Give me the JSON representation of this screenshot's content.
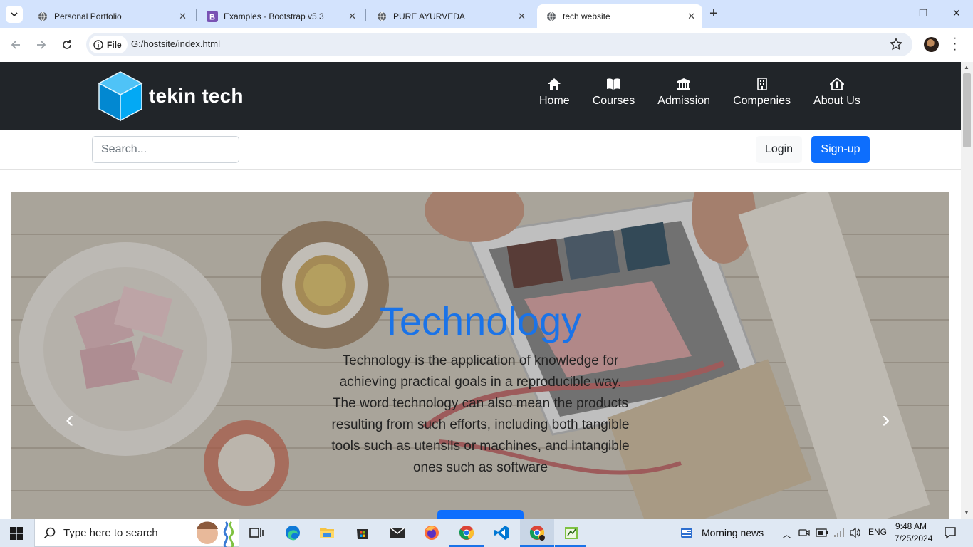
{
  "browser": {
    "tabs": [
      {
        "title": "Personal Portfolio",
        "favicon": "globe-icon"
      },
      {
        "title": "Examples · Bootstrap v5.3",
        "favicon": "bootstrap-icon"
      },
      {
        "title": "PURE AYURVEDA",
        "favicon": "globe-icon"
      },
      {
        "title": "tech website",
        "favicon": "globe-icon",
        "active": true
      }
    ],
    "address": {
      "chip_label": "File",
      "url": "G:/hostsite/index.html"
    }
  },
  "site": {
    "brand": "tekin tech",
    "nav": [
      {
        "label": "Home",
        "icon": "house-icon"
      },
      {
        "label": "Courses",
        "icon": "book-icon"
      },
      {
        "label": "Admission",
        "icon": "bank-icon"
      },
      {
        "label": "Compenies",
        "icon": "building-icon"
      },
      {
        "label": "About Us",
        "icon": "house-info-icon"
      }
    ],
    "search_placeholder": "Search...",
    "login_label": "Login",
    "signup_label": "Sign-up",
    "hero": {
      "title": "Technology",
      "text": "Technology is the application of knowledge for achieving practical goals in a reproducible way. The word technology can also mean the products resulting from such efforts, including both tangible tools such as utensils or machines, and intangible ones such as software"
    }
  },
  "taskbar": {
    "search_placeholder": "Type here to search",
    "news": "Morning news",
    "lang": "ENG",
    "time": "9:48 AM",
    "date": "7/25/2024"
  },
  "colors": {
    "primary": "#0d6efd",
    "header_bg": "#212529",
    "hero_title": "#1a73e8"
  }
}
